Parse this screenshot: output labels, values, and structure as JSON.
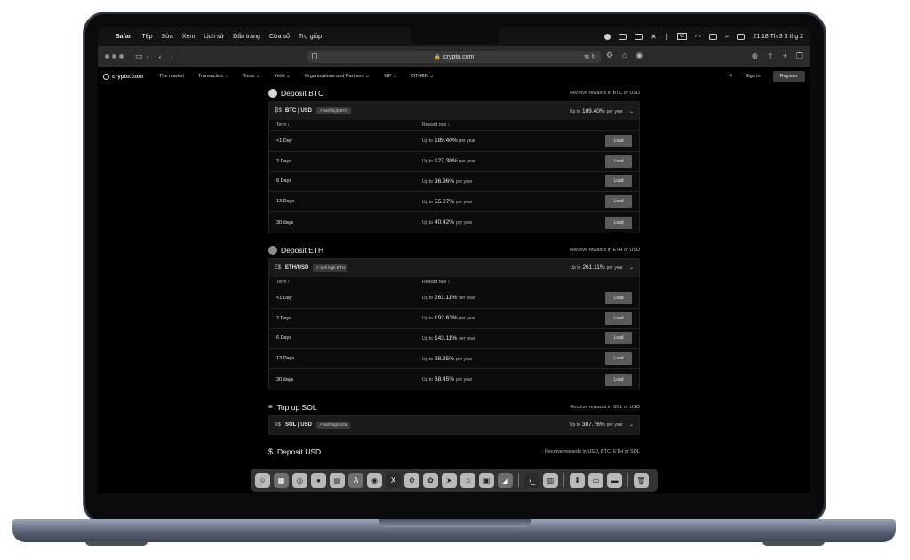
{
  "menubar": {
    "apple": "",
    "items": [
      "Safari",
      "Tệp",
      "Sửa",
      "Xem",
      "Lịch sử",
      "Dấu trang",
      "Cửa sổ",
      "Trợ giúp"
    ],
    "clock": "21:18 Th 3 3 thg 2",
    "badge": "VI"
  },
  "browser": {
    "url": "crypto.com"
  },
  "site": {
    "logo": "crypto.com",
    "nav": [
      "The market",
      "Transaction",
      "Tools",
      "Yield",
      "Organizations and Partners",
      "VIP",
      "OTHER"
    ],
    "sign_in": "Sign in",
    "register": "Register"
  },
  "sections": [
    {
      "title": "Deposit BTC",
      "note": "Receive rewards in BTC or USD",
      "pair": "BTC | USD",
      "pair_icon": "₿$",
      "tag": "↗ Sell high BTC",
      "up_to_prefix": "Up to",
      "up_to_value": "189.40%",
      "up_to_suffix": "per year",
      "col_term": "Term ↕",
      "col_rate": "Reward rate ↕",
      "rows": [
        {
          "term": "<1 Day",
          "rate": "189.40%"
        },
        {
          "term": "2 Days",
          "rate": "127.30%"
        },
        {
          "term": "6 Days",
          "rate": "96.96%"
        },
        {
          "term": "13 Days",
          "rate": "55.07%"
        },
        {
          "term": "30 days",
          "rate": "40.42%"
        }
      ]
    },
    {
      "title": "Deposit ETH",
      "note": "Receive rewards in ETH or USD",
      "pair": "ETH/USD",
      "pair_icon": "Ξ$",
      "tag": "↗ Sell high ETH",
      "up_to_prefix": "Up to",
      "up_to_value": "261.11%",
      "up_to_suffix": "per year",
      "col_term": "Term ↕",
      "col_rate": "Reward rate ↕",
      "rows": [
        {
          "term": "<1 Day",
          "rate": "261.11%"
        },
        {
          "term": "2 Days",
          "rate": "192.63%"
        },
        {
          "term": "6 Days",
          "rate": "143.11%"
        },
        {
          "term": "13 Days",
          "rate": "98.35%"
        },
        {
          "term": "30 days",
          "rate": "68.45%"
        }
      ]
    },
    {
      "title": "Top up SOL",
      "note": "Receive rewards in SOL or USD",
      "pair": "SOL | USD",
      "pair_icon": "≡$",
      "tag": "↗ Sell high SOL",
      "up_to_prefix": "Up to",
      "up_to_value": "387.76%",
      "up_to_suffix": "per year"
    },
    {
      "title": "Deposit USD",
      "note": "Receive rewards in USD, BTC, ETH or SOL"
    }
  ],
  "labels": {
    "per_year": "per year",
    "up_to": "Up to",
    "load": "Load"
  },
  "dock_icons": [
    "finder-icon",
    "launchpad-icon",
    "safari-icon",
    "messages-icon",
    "notes-icon",
    "appstore-icon",
    "chrome-icon",
    "x-icon",
    "settings-icon",
    "photos-icon",
    "telegram-icon",
    "music-icon",
    "preview-icon",
    "terminal-icon",
    "iterm-icon",
    "finder2-icon",
    "trash-icon"
  ],
  "colors": {
    "page_bg": "#000000",
    "panel_bg": "#0c0c0d",
    "button_bg": "#5a5a5c",
    "register_bg": "#3c3c3e"
  }
}
